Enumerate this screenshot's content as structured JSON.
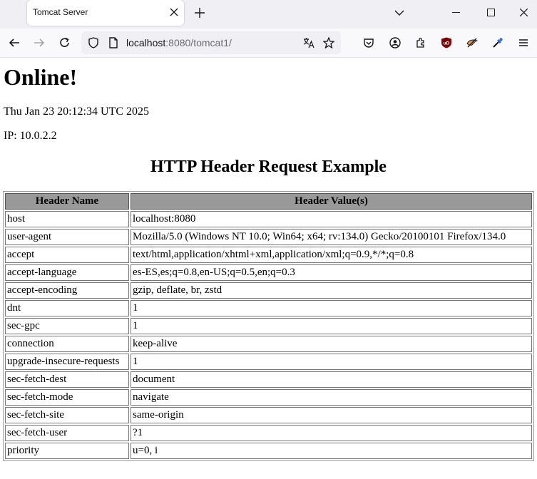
{
  "browser": {
    "tab_title": "Tomcat Server",
    "url_host": "localhost",
    "url_rest": ":8080/tomcat1/"
  },
  "page": {
    "heading": "Online!",
    "datetime": "Thu Jan 23 20:12:34 UTC 2025",
    "ip": "IP: 10.0.2.2",
    "caption": "HTTP Header Request Example",
    "columns": [
      "Header Name",
      "Header Value(s)"
    ],
    "rows": [
      {
        "name": "host",
        "value": "localhost:8080"
      },
      {
        "name": "user-agent",
        "value": "Mozilla/5.0 (Windows NT 10.0; Win64; x64; rv:134.0) Gecko/20100101 Firefox/134.0"
      },
      {
        "name": "accept",
        "value": "text/html,application/xhtml+xml,application/xml;q=0.9,*/*;q=0.8"
      },
      {
        "name": "accept-language",
        "value": "es-ES,es;q=0.8,en-US;q=0.5,en;q=0.3"
      },
      {
        "name": "accept-encoding",
        "value": "gzip, deflate, br, zstd"
      },
      {
        "name": "dnt",
        "value": "1"
      },
      {
        "name": "sec-gpc",
        "value": "1"
      },
      {
        "name": "connection",
        "value": "keep-alive"
      },
      {
        "name": "upgrade-insecure-requests",
        "value": "1"
      },
      {
        "name": "sec-fetch-dest",
        "value": "document"
      },
      {
        "name": "sec-fetch-mode",
        "value": "navigate"
      },
      {
        "name": "sec-fetch-site",
        "value": "same-origin"
      },
      {
        "name": "sec-fetch-user",
        "value": "?1"
      },
      {
        "name": "priority",
        "value": "u=0, i"
      }
    ]
  }
}
